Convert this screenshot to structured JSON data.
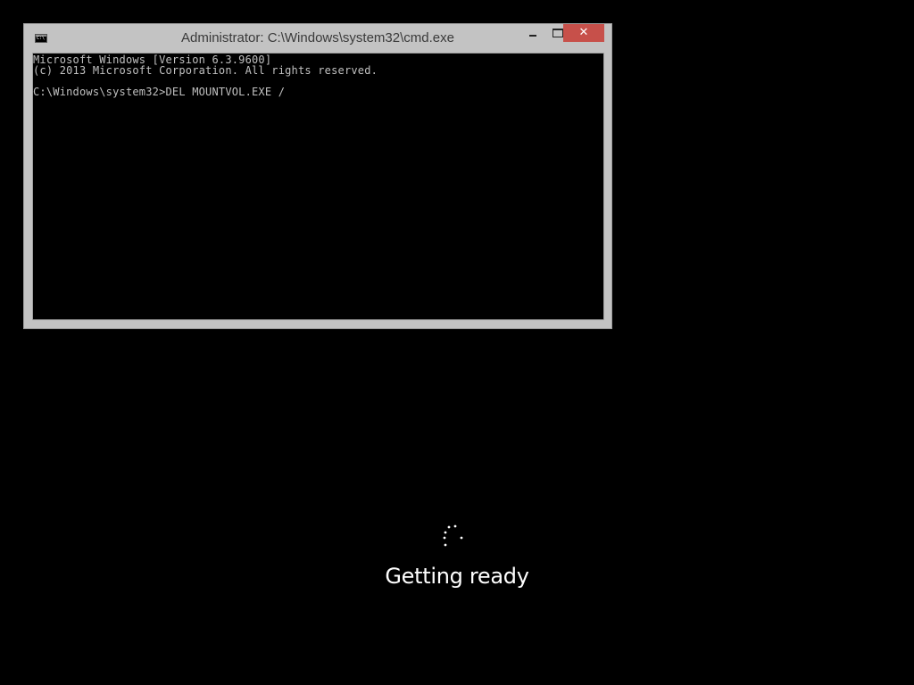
{
  "window": {
    "title": "Administrator: C:\\Windows\\system32\\cmd.exe",
    "close_glyph": "✕",
    "console_lines": [
      "Microsoft Windows [Version 6.3.9600]",
      "(c) 2013 Microsoft Corporation. All rights reserved.",
      "",
      "C:\\Windows\\system32>DEL MOUNTVOL.EXE /"
    ]
  },
  "status": {
    "message": "Getting ready"
  },
  "colors": {
    "background": "#000000",
    "window_frame": "#c3c3c3",
    "close_button": "#c7504a",
    "console_text": "#c0c0c0"
  },
  "icons": {
    "app": "cmd-icon",
    "minimize": "minimize-icon",
    "maximize": "maximize-icon",
    "close": "close-icon",
    "spinner": "loading-spinner-icon"
  }
}
